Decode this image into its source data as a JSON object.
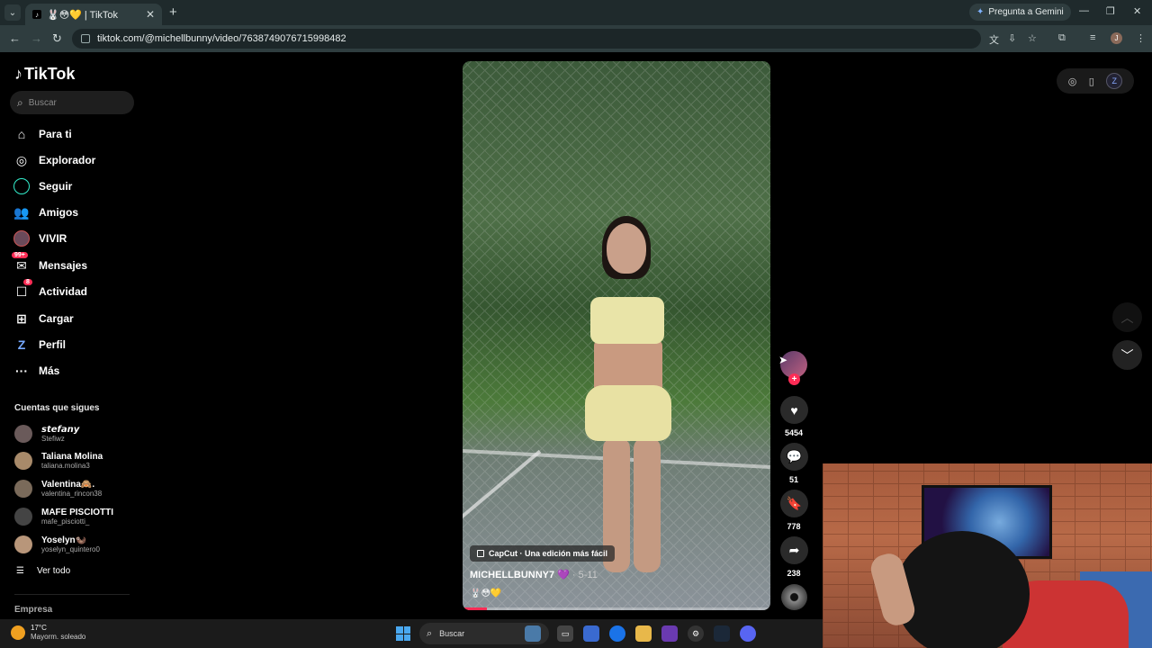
{
  "browser": {
    "tab_title": "🐰😳💛 | TikTok",
    "new_tab": "+",
    "gemini_label": "Pregunta a Gemini",
    "url": "tiktok.com/@michellbunny/video/7638749076715998482",
    "profile_initial": "J"
  },
  "sidebar": {
    "logo": "TikTok",
    "search_placeholder": "Buscar",
    "nav": [
      {
        "label": "Para ti",
        "icon": "home-icon"
      },
      {
        "label": "Explorador",
        "icon": "compass-icon"
      },
      {
        "label": "Seguir",
        "icon": "following-icon"
      },
      {
        "label": "Amigos",
        "icon": "friends-icon"
      },
      {
        "label": "VIVIR",
        "icon": "live-icon"
      },
      {
        "label": "Mensajes",
        "icon": "messages-icon",
        "badge": "99+"
      },
      {
        "label": "Actividad",
        "icon": "activity-icon",
        "badge": "8"
      },
      {
        "label": "Cargar",
        "icon": "upload-icon"
      },
      {
        "label": "Perfil",
        "icon": "profile-icon"
      },
      {
        "label": "Más",
        "icon": "more-icon"
      }
    ],
    "following_title": "Cuentas que sigues",
    "accounts": [
      {
        "name": "𝙨𝙩𝙚𝙛𝙖𝙣𝙮",
        "handle": "Stefiwz"
      },
      {
        "name": "Taliana Molina",
        "handle": "taliana.molina3"
      },
      {
        "name": "Valentina🙈.",
        "handle": "valentina_rincon38"
      },
      {
        "name": "MAFE PISCIOTTI",
        "handle": "mafe_pisciotti_"
      },
      {
        "name": "Yoselyn🦦",
        "handle": "yoselyn_quintero0"
      }
    ],
    "see_all": "Ver todo",
    "company": "Empresa"
  },
  "video": {
    "capcut": "CapCut · Una edición más fácil",
    "username": "MICHELLBUNNY7 💜",
    "date": " · 5-11",
    "description": "🐰😳💛",
    "progress": 0.08
  },
  "actions": {
    "likes": "5454",
    "comments": "51",
    "saves": "778",
    "shares": "238"
  },
  "taskbar": {
    "temp": "17°C",
    "weather": "Mayorm. soleado",
    "search": "Buscar"
  }
}
